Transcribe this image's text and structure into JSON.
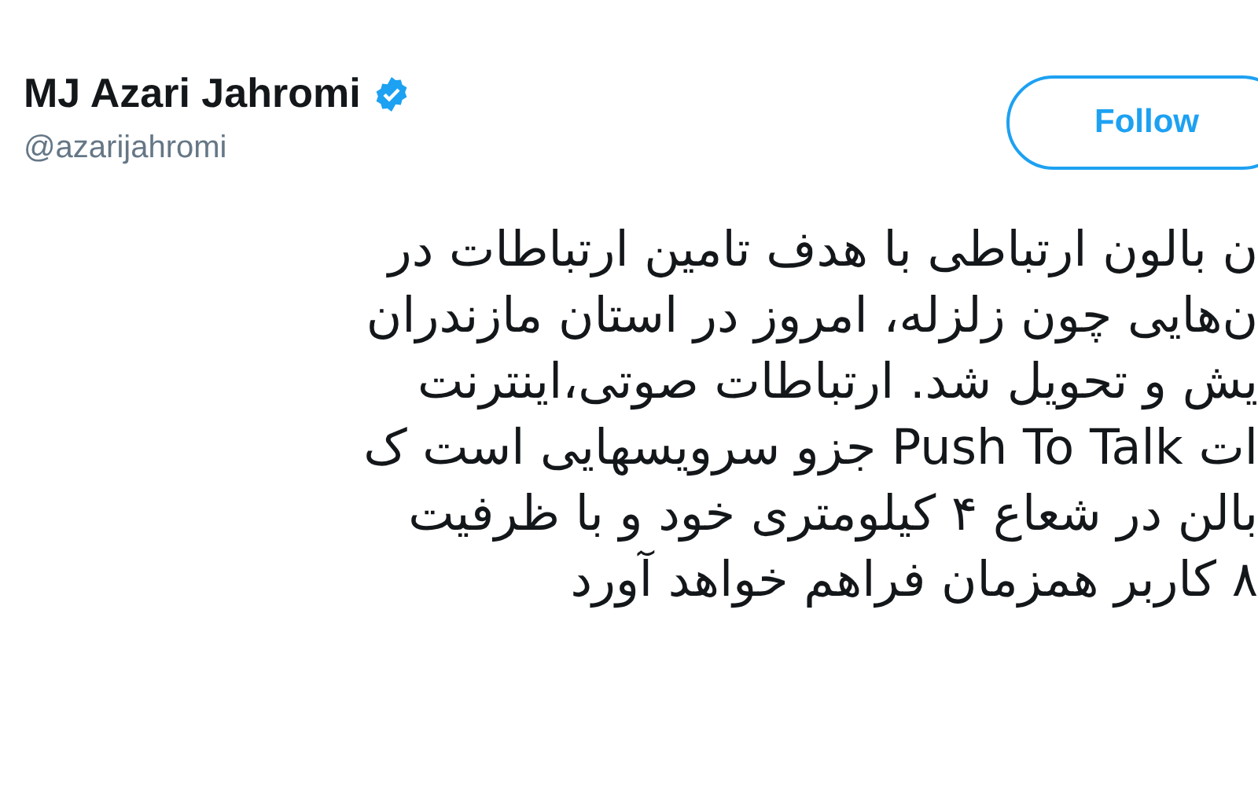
{
  "author": {
    "name": "MJ Azari Jahromi",
    "verified": true,
    "handle": "@azarijahromi"
  },
  "follow_button": {
    "label": "Follow"
  },
  "tweet_lines": [
    "ن بالون ارتباطی با هدف تامین ارتباطات در",
    "ن‌هایی چون زلزله، امروز در استان مازندران",
    "یش و تحویل شد. ارتباطات صوتی،اینترنت",
    "ات Push To Talk جزو سرویسهایی است ک",
    "بالن در شعاع ۴ کیلومتری خود و با ظرفیت",
    "۸ کاربر همزمان فراهم خواهد آورد"
  ]
}
